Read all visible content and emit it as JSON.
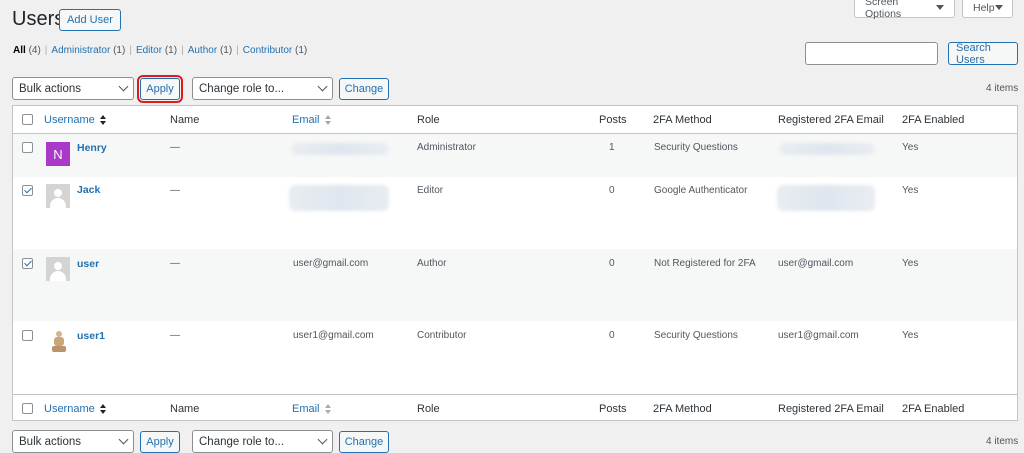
{
  "header": {
    "title": "Users",
    "add_user": "Add User",
    "screen_options": "Screen Options",
    "help": "Help"
  },
  "filters": [
    {
      "label": "All",
      "count": "(4)"
    },
    {
      "label": "Administrator",
      "count": "(1)"
    },
    {
      "label": "Editor",
      "count": "(1)"
    },
    {
      "label": "Author",
      "count": "(1)"
    },
    {
      "label": "Contributor",
      "count": "(1)"
    }
  ],
  "search": {
    "button": "Search Users",
    "value": ""
  },
  "tablenav": {
    "bulk_actions": "Bulk actions",
    "apply": "Apply",
    "change_role": "Change role to...",
    "change": "Change",
    "items": "4 items"
  },
  "columns": {
    "username": "Username",
    "name": "Name",
    "email": "Email",
    "role": "Role",
    "posts": "Posts",
    "twofa_method": "2FA Method",
    "reg_email": "Registered 2FA Email",
    "twofa_enabled": "2FA Enabled"
  },
  "rows": [
    {
      "username": "Henry",
      "avatar_letter": "N",
      "name": "—",
      "email": "",
      "role": "Administrator",
      "posts": "1",
      "method": "Security Questions",
      "reg_email": "",
      "enabled": "Yes",
      "checked": false
    },
    {
      "username": "Jack",
      "name": "—",
      "email": "",
      "role": "Editor",
      "posts": "0",
      "method": "Google Authenticator",
      "reg_email": "",
      "enabled": "Yes",
      "checked": true
    },
    {
      "username": "user",
      "name": "—",
      "email": "user@gmail.com",
      "role": "Author",
      "posts": "0",
      "method": "Not Registered for 2FA",
      "reg_email": "user@gmail.com",
      "enabled": "Yes",
      "checked": true
    },
    {
      "username": "user1",
      "name": "—",
      "email": "user1@gmail.com",
      "role": "Contributor",
      "posts": "0",
      "method": "Security Questions",
      "reg_email": "user1@gmail.com",
      "enabled": "Yes",
      "checked": false
    }
  ],
  "colors": {
    "accent": "#2271b1",
    "highlight": "#e21a1a",
    "avatar": "#a839c9"
  }
}
